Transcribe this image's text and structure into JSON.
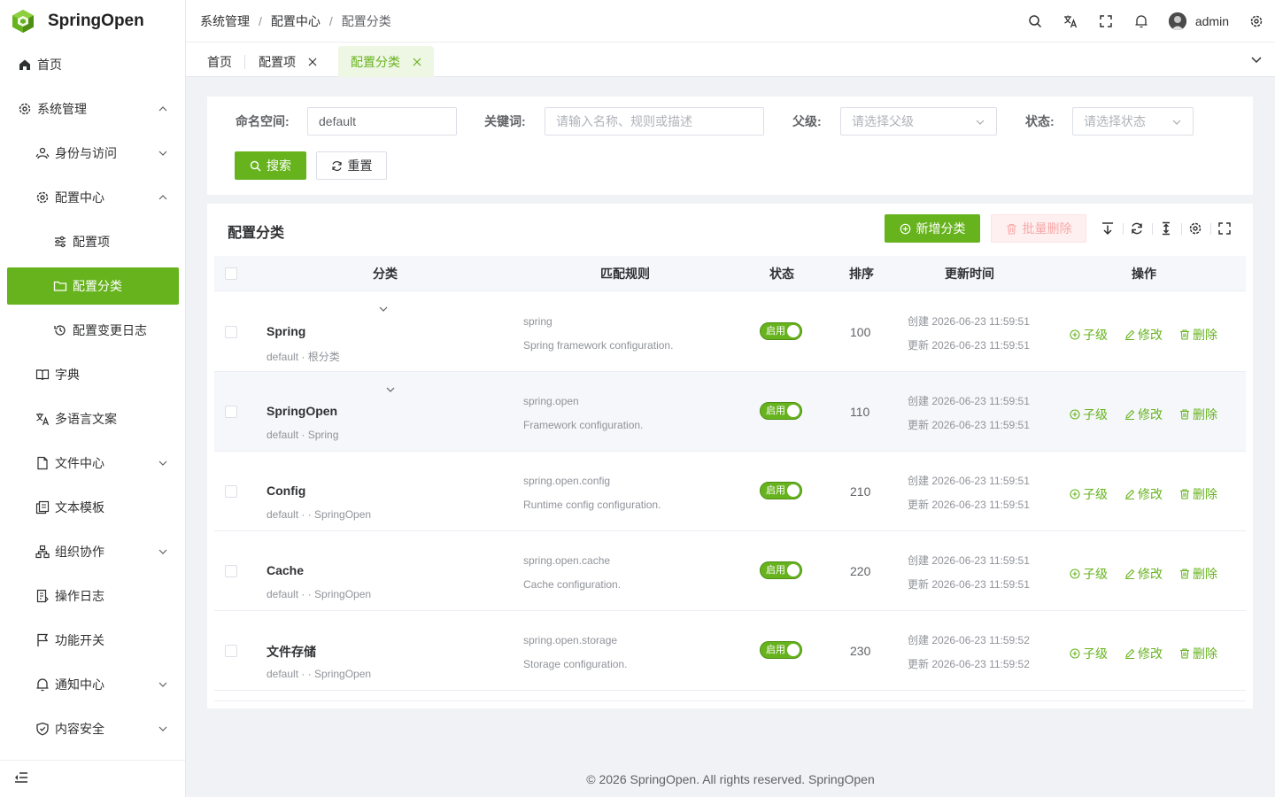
{
  "app": {
    "name": "SpringOpen"
  },
  "colors": {
    "accent": "#67b31e",
    "danger_light": "#f9a7a7"
  },
  "sidebar": {
    "items": [
      {
        "label": "首页",
        "icon": "home-icon"
      },
      {
        "label": "系统管理",
        "icon": "gear-icon",
        "expanded": true
      },
      {
        "label": "身份与访问",
        "icon": "users-icon",
        "expanded": false
      },
      {
        "label": "配置中心",
        "icon": "gear-icon",
        "expanded": true
      },
      {
        "label": "配置项",
        "icon": "sliders-icon"
      },
      {
        "label": "配置分类",
        "icon": "folder-icon",
        "active": true
      },
      {
        "label": "配置变更日志",
        "icon": "history-icon"
      },
      {
        "label": "字典",
        "icon": "book-icon"
      },
      {
        "label": "多语言文案",
        "icon": "translate-icon"
      },
      {
        "label": "文件中心",
        "icon": "file-icon",
        "expanded": false
      },
      {
        "label": "文本模板",
        "icon": "copy-icon"
      },
      {
        "label": "组织协作",
        "icon": "org-icon",
        "expanded": false
      },
      {
        "label": "操作日志",
        "icon": "log-icon"
      },
      {
        "label": "功能开关",
        "icon": "flag-icon"
      },
      {
        "label": "通知中心",
        "icon": "bell-icon",
        "expanded": false
      },
      {
        "label": "内容安全",
        "icon": "shield-icon",
        "expanded": false
      }
    ]
  },
  "header": {
    "breadcrumb": [
      "系统管理",
      "配置中心",
      "配置分类"
    ],
    "separator": "/",
    "username": "admin"
  },
  "tabs": [
    {
      "label": "首页"
    },
    {
      "label": "配置项"
    },
    {
      "label": "配置分类",
      "active": true
    }
  ],
  "search": {
    "namespace_label": "命名空间:",
    "namespace_value": "default",
    "keyword_label": "关键词:",
    "keyword_placeholder": "请输入名称、规则或描述",
    "parent_label": "父级:",
    "parent_placeholder": "请选择父级",
    "status_label": "状态:",
    "status_placeholder": "请选择状态",
    "search_button": "搜索",
    "reset_button": "重置"
  },
  "table": {
    "title": "配置分类",
    "add_button": "新增分类",
    "batch_delete_button": "批量删除",
    "columns": [
      "分类",
      "匹配规则",
      "状态",
      "排序",
      "更新时间",
      "操作"
    ],
    "created_prefix": "创建",
    "updated_prefix": "更新",
    "actions": [
      "子级",
      "修改",
      "删除"
    ],
    "rows": [
      {
        "name": "Spring",
        "path": "default · 根分类",
        "rule": "spring",
        "desc": "Spring framework configuration.",
        "status": "启用",
        "sort": "100",
        "created": "2026-06-23 11:59:51",
        "updated": "2026-06-23 11:59:51"
      },
      {
        "name": "SpringOpen",
        "path": "default · Spring",
        "rule": "spring.open",
        "desc": "Framework configuration.",
        "status": "启用",
        "sort": "110",
        "created": "2026-06-23 11:59:51",
        "updated": "2026-06-23 11:59:51"
      },
      {
        "name": "Config",
        "path": "default · · SpringOpen",
        "rule": "spring.open.config",
        "desc": "Runtime config configuration.",
        "status": "启用",
        "sort": "210",
        "created": "2026-06-23 11:59:51",
        "updated": "2026-06-23 11:59:51"
      },
      {
        "name": "Cache",
        "path": "default · · SpringOpen",
        "rule": "spring.open.cache",
        "desc": "Cache configuration.",
        "status": "启用",
        "sort": "220",
        "created": "2026-06-23 11:59:51",
        "updated": "2026-06-23 11:59:51"
      },
      {
        "name": "文件存储",
        "path": "default · · SpringOpen",
        "rule": "spring.open.storage",
        "desc": "Storage configuration.",
        "status": "启用",
        "sort": "230",
        "created": "2026-06-23 11:59:52",
        "updated": "2026-06-23 11:59:52"
      }
    ]
  },
  "footer": {
    "text": "© 2026 SpringOpen. All rights reserved. SpringOpen"
  }
}
